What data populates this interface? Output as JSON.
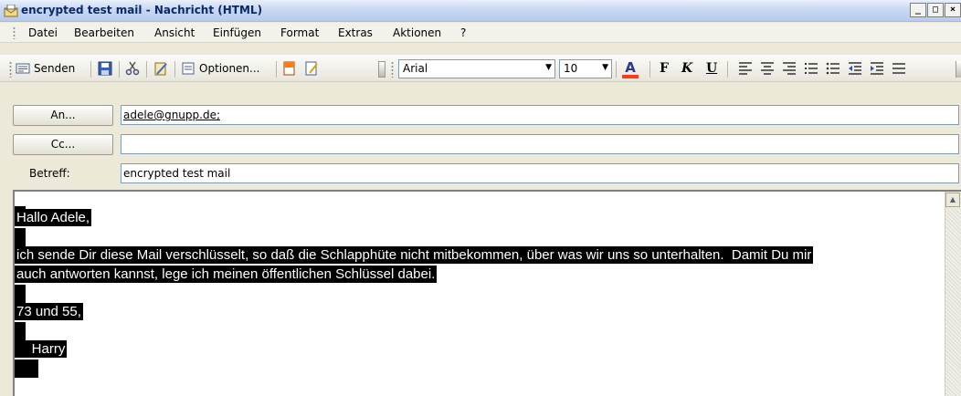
{
  "window": {
    "title": "encrypted test mail - Nachricht (HTML)",
    "controls": [
      "_",
      "□",
      "×"
    ]
  },
  "menu": [
    {
      "label": "Datei",
      "accel": "D"
    },
    {
      "label": "Bearbeiten",
      "accel": "B"
    },
    {
      "label": "Ansicht",
      "accel": "A"
    },
    {
      "label": "Einfügen",
      "accel": "E"
    },
    {
      "label": "Format",
      "accel": "t"
    },
    {
      "label": "Extras",
      "accel": "x"
    },
    {
      "label": "Aktionen",
      "accel": "t"
    },
    {
      "label": "?",
      "accel": "?"
    }
  ],
  "toolbar": {
    "send_label": "Senden",
    "options_label": "Optionen...",
    "font_name": "Arial",
    "font_size": "10",
    "bold_glyph": "F",
    "italic_glyph": "K",
    "underline_glyph": "U"
  },
  "header": {
    "to_button": "An...",
    "cc_button": "Cc...",
    "subject_label": "Betreff:",
    "to_value": "adele@gnupp.de;",
    "cc_value": "",
    "subject_value": "encrypted test mail"
  },
  "body": {
    "lines": [
      "Hallo Adele,",
      "ich sende Dir diese Mail verschlüsselt, so daß die Schlapphüte nicht mitbekommen, über was wir uns so unterhalten.  Damit Du mir",
      "auch antworten kannst, lege ich meinen öffentlichen Schlüssel dabei.",
      "73 und 55,",
      "    Harry"
    ]
  },
  "colors": {
    "title_text": "#0b2a6b",
    "selection_bg": "#000000",
    "selection_fg": "#ffffff",
    "font_color_indicator": "#ff3b1d"
  }
}
